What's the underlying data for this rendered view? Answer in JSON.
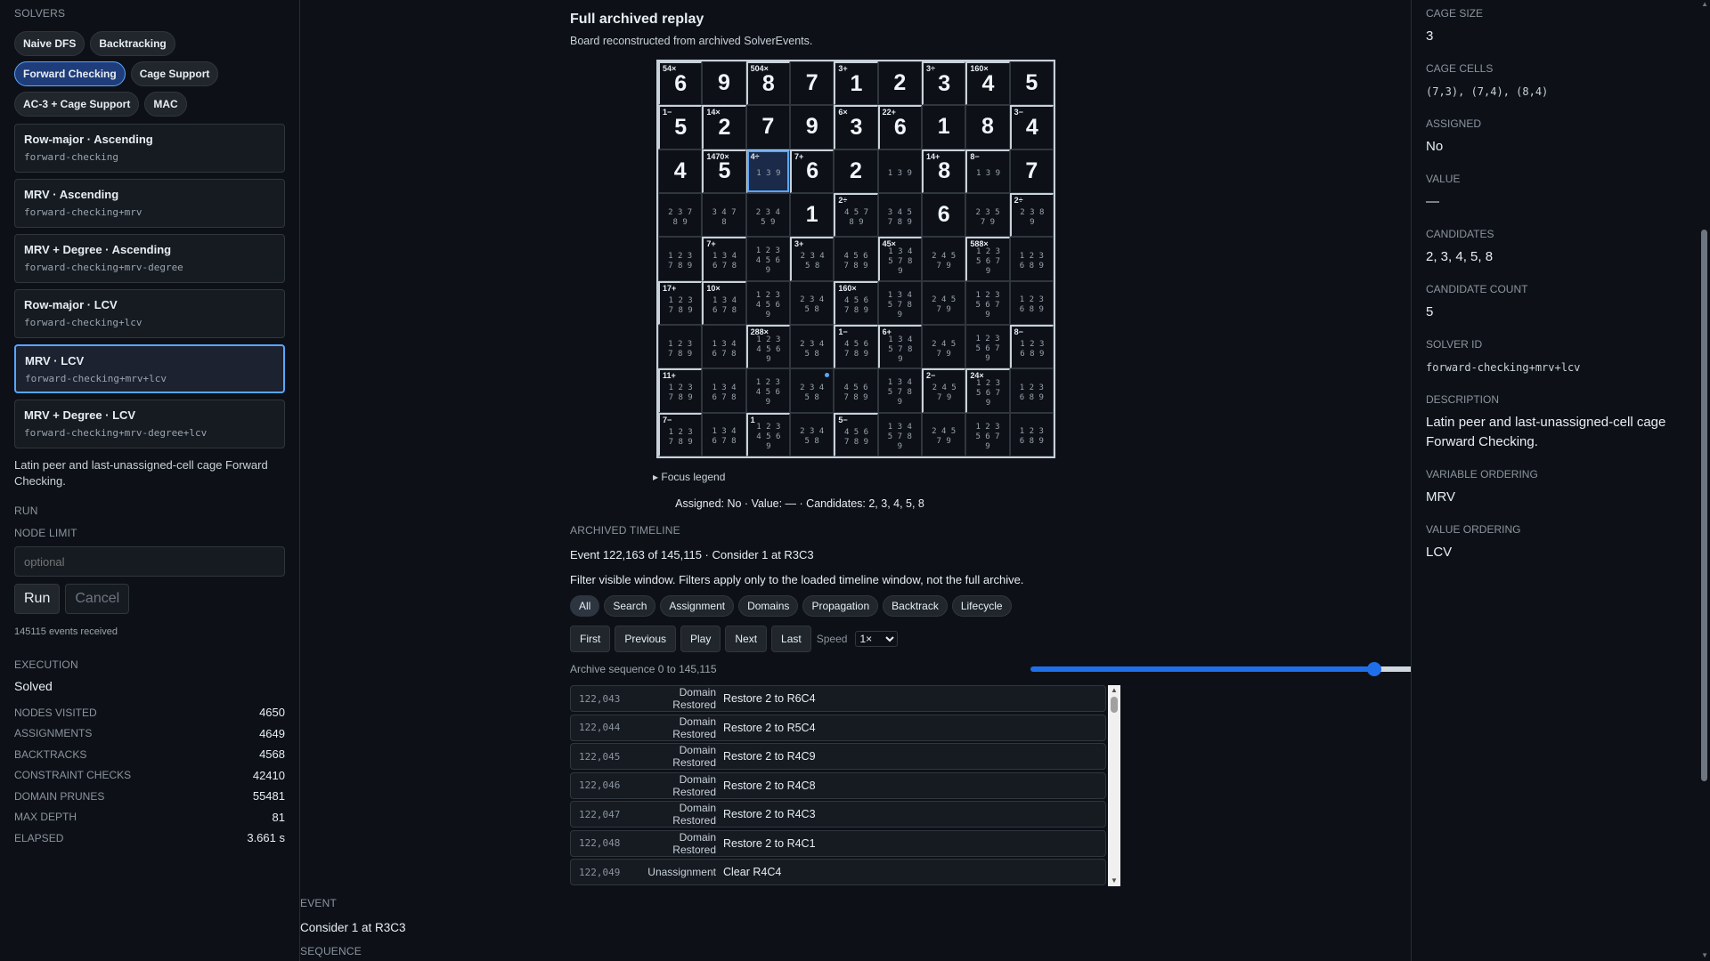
{
  "left": {
    "solvers_heading": "SOLVERS",
    "solver_chips": [
      {
        "label": "Naive DFS"
      },
      {
        "label": "Backtracking"
      },
      {
        "label": "Forward Checking"
      },
      {
        "label": "Cage Support"
      },
      {
        "label": "AC-3 + Cage Support"
      },
      {
        "label": "MAC"
      }
    ],
    "configs": [
      {
        "title": "Row-major · Ascending",
        "id": "forward-checking"
      },
      {
        "title": "MRV · Ascending",
        "id": "forward-checking+mrv"
      },
      {
        "title": "MRV + Degree · Ascending",
        "id": "forward-checking+mrv-degree"
      },
      {
        "title": "Row-major · LCV",
        "id": "forward-checking+lcv"
      },
      {
        "title": "MRV · LCV",
        "id": "forward-checking+mrv+lcv"
      },
      {
        "title": "MRV + Degree · LCV",
        "id": "forward-checking+mrv-degree+lcv"
      }
    ],
    "description": "Latin peer and last-unassigned-cell cage Forward Checking.",
    "run_heading": "RUN",
    "node_limit_label": "NODE LIMIT",
    "node_limit_placeholder": "optional",
    "run_label": "Run",
    "cancel_label": "Cancel",
    "events_received": "145115 events received",
    "execution_heading": "EXECUTION",
    "execution_status": "Solved",
    "stats": [
      {
        "k": "NODES VISITED",
        "v": "4650"
      },
      {
        "k": "ASSIGNMENTS",
        "v": "4649"
      },
      {
        "k": "BACKTRACKS",
        "v": "4568"
      },
      {
        "k": "CONSTRAINT CHECKS",
        "v": "42410"
      },
      {
        "k": "DOMAIN PRUNES",
        "v": "55481"
      },
      {
        "k": "MAX DEPTH",
        "v": "81"
      },
      {
        "k": "ELAPSED",
        "v": "3.661 s"
      }
    ]
  },
  "center": {
    "title": "Full archived replay",
    "subtitle": "Board reconstructed from archived SolverEvents.",
    "focus_legend": "▸ Focus legend",
    "focus_summary": "Assigned: No · Value: — · Candidates: 2, 3, 4, 5, 8",
    "timeline_heading": "ARCHIVED TIMELINE",
    "event_line": "Event 122,163 of 145,115 · Consider 1 at R3C3",
    "filter_note": "Filter visible window. Filters apply only to the loaded timeline window, not the full archive.",
    "filters": [
      {
        "label": "All"
      },
      {
        "label": "Search"
      },
      {
        "label": "Assignment"
      },
      {
        "label": "Domains"
      },
      {
        "label": "Propagation"
      },
      {
        "label": "Backtrack"
      },
      {
        "label": "Lifecycle"
      }
    ],
    "nav": {
      "first": "First",
      "previous": "Previous",
      "play": "Play",
      "next": "Next",
      "last": "Last",
      "speed_label": "Speed",
      "speed_value": "1×"
    },
    "archive_label": "Archive sequence 0 to 145,115",
    "slider_fraction": 0.842,
    "events": [
      {
        "n": "122,043",
        "type": "Domain Restored",
        "desc": "Restore 2 to R6C4"
      },
      {
        "n": "122,044",
        "type": "Domain Restored",
        "desc": "Restore 2 to R5C4"
      },
      {
        "n": "122,045",
        "type": "Domain Restored",
        "desc": "Restore 2 to R4C9"
      },
      {
        "n": "122,046",
        "type": "Domain Restored",
        "desc": "Restore 2 to R4C8"
      },
      {
        "n": "122,047",
        "type": "Domain Restored",
        "desc": "Restore 2 to R4C3"
      },
      {
        "n": "122,048",
        "type": "Domain Restored",
        "desc": "Restore 2 to R4C1"
      },
      {
        "n": "122,049",
        "type": "Unassignment",
        "desc": "Clear R4C4"
      }
    ],
    "bottom": {
      "event_label": "EVENT",
      "event_value": "Consider 1 at R3C3",
      "sequence_label": "SEQUENCE"
    }
  },
  "board": {
    "cells": [
      [
        {
          "c": "54×",
          "v": "6"
        },
        {
          "v": "9"
        },
        {
          "c": "504×",
          "v": "8"
        },
        {
          "v": "7"
        },
        {
          "c": "3+",
          "v": "1"
        },
        {
          "v": "2"
        },
        {
          "c": "3÷",
          "v": "3"
        },
        {
          "c": "160×",
          "v": "4"
        },
        {
          "v": "5"
        }
      ],
      [
        {
          "c": "1−",
          "v": "5"
        },
        {
          "c": "14×",
          "v": "2"
        },
        {
          "v": "7"
        },
        {
          "v": "9"
        },
        {
          "c": "6×",
          "v": "3"
        },
        {
          "c": "22+",
          "v": "6"
        },
        {
          "v": "1"
        },
        {
          "v": "8"
        },
        {
          "c": "3−",
          "v": "4"
        }
      ],
      [
        {
          "v": "4"
        },
        {
          "c": "1470×",
          "v": "5"
        },
        {
          "c": "4÷",
          "k": "1 3 9",
          "focus": true
        },
        {
          "c": "7+",
          "v": "6"
        },
        {
          "v": "2"
        },
        {
          "k": "1 3 9"
        },
        {
          "c": "14+",
          "v": "8"
        },
        {
          "c": "8−",
          "k": "1 3 9"
        },
        {
          "v": "7"
        }
      ],
      [
        {
          "k": "2 3 7\n8 9"
        },
        {
          "k": "3 4 7\n8"
        },
        {
          "k": "2 3 4\n5 9"
        },
        {
          "v": "1"
        },
        {
          "c": "2÷",
          "k": "4 5 7\n8 9"
        },
        {
          "k": "3 4 5\n7 8 9"
        },
        {
          "v": "6"
        },
        {
          "k": "2 3 5\n7 9"
        },
        {
          "c": "2÷",
          "k": "2 3 8\n9"
        }
      ],
      [
        {
          "k": "1 2 3\n7 8 9"
        },
        {
          "c": "7+",
          "k": "1 3 4\n6 7 8"
        },
        {
          "k": "1 2 3\n4 5 6\n9"
        },
        {
          "c": "3+",
          "k": "2 3 4\n5 8"
        },
        {
          "k": "4 5 6\n7 8 9"
        },
        {
          "c": "45×",
          "k": "1 3 4\n5 7 8\n9"
        },
        {
          "k": "2 4 5\n7 9"
        },
        {
          "c": "588×",
          "k": "1 2 3\n5 6 7\n9"
        },
        {
          "k": "1 2 3\n6 8 9"
        }
      ],
      [
        {
          "c": "17+",
          "k": "1 2 3\n7 8 9"
        },
        {
          "c": "10×",
          "k": "1 3 4\n6 7 8"
        },
        {
          "k": "1 2 3\n4 5 6\n9"
        },
        {
          "k": "2 3 4\n5 8"
        },
        {
          "c": "160×",
          "k": "4 5 6\n7 8 9"
        },
        {
          "k": "1 3 4\n5 7 8\n9"
        },
        {
          "k": "2 4 5\n7 9"
        },
        {
          "k": "1 2 3\n5 6 7\n9"
        },
        {
          "k": "1 2 3\n6 8 9"
        }
      ],
      [
        {
          "k": "1 2 3\n7 8 9"
        },
        {
          "k": "1 3 4\n6 7 8"
        },
        {
          "c": "288×",
          "k": "1 2 3\n4 5 6\n9"
        },
        {
          "k": "2 3 4\n5 8"
        },
        {
          "c": "1−",
          "k": "4 5 6\n7 8 9"
        },
        {
          "c": "6+",
          "k": "1 3 4\n5 7 8\n9"
        },
        {
          "k": "2 4 5\n7 9"
        },
        {
          "k": "1 2 3\n5 6 7\n9"
        },
        {
          "c": "8−",
          "k": "1 2 3\n6 8 9"
        }
      ],
      [
        {
          "c": "11+",
          "k": "1 2 3\n7 8 9"
        },
        {
          "k": "1 3 4\n6 7 8"
        },
        {
          "k": "1 2 3\n4 5 6\n9"
        },
        {
          "k": "2 3 4\n5 8",
          "dot": true
        },
        {
          "k": "4 5 6\n7 8 9"
        },
        {
          "k": "1 3 4\n5 7 8\n9"
        },
        {
          "c": "2−",
          "k": "2 4 5\n7 9"
        },
        {
          "c": "24×",
          "k": "1 2 3\n5 6 7\n9"
        },
        {
          "k": "1 2 3\n6 8 9"
        }
      ],
      [
        {
          "c": "7−",
          "k": "1 2 3\n7 8 9"
        },
        {
          "k": "1 3 4\n6 7 8"
        },
        {
          "c": "1",
          "k": "1 2 3\n4 5 6\n9"
        },
        {
          "k": "2 3 4\n5 8"
        },
        {
          "c": "5−",
          "k": "4 5 6\n7 8 9"
        },
        {
          "k": "1 3 4\n5 7 8\n9"
        },
        {
          "k": "2 4 5\n7 9"
        },
        {
          "k": "1 2 3\n5 6 7\n9"
        },
        {
          "k": "1 2 3\n6 8 9"
        }
      ]
    ]
  },
  "right": {
    "fields": [
      {
        "k": "CAGE SIZE",
        "v": "3"
      },
      {
        "k": "CAGE CELLS",
        "v": "(7,3), (7,4), (8,4)",
        "mono": true
      },
      {
        "k": "ASSIGNED",
        "v": "No"
      },
      {
        "k": "VALUE",
        "v": "—"
      },
      {
        "k": "CANDIDATES",
        "v": "2, 3, 4, 5, 8"
      },
      {
        "k": "CANDIDATE COUNT",
        "v": "5"
      },
      {
        "k": "SOLVER ID",
        "v": "forward-checking+mrv+lcv",
        "mono": true
      },
      {
        "k": "DESCRIPTION",
        "v": "Latin peer and last-unassigned-cell cage Forward Checking."
      },
      {
        "k": "VARIABLE ORDERING",
        "v": "MRV"
      },
      {
        "k": "VALUE ORDERING",
        "v": "LCV"
      }
    ]
  },
  "colors": {
    "accent": "#58a6ff",
    "bg": "#0d1117",
    "panel": "#161b22"
  }
}
